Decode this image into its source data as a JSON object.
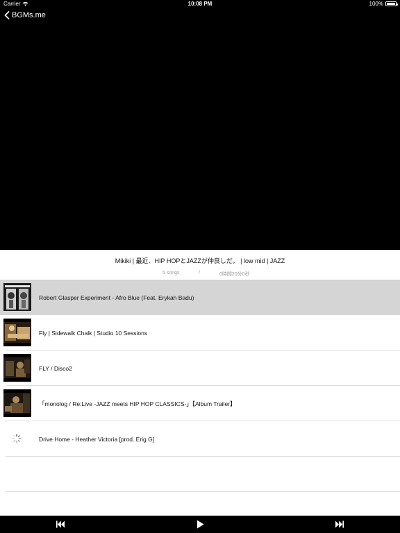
{
  "status_bar": {
    "carrier": "Carrier",
    "time": "10:08 PM",
    "battery": "100%"
  },
  "nav": {
    "back_label": "BGMs.me"
  },
  "playlist": {
    "title": "Mikiki | 最近、HIP HOPとJAZZが仲良しだ。 | low mid | JAZZ",
    "song_count": "5 songs",
    "separator": "/",
    "duration": "0時間20分0秒"
  },
  "songs": [
    {
      "title": "Robert Glasper Experiment - Afro Blue (Feat. Erykah Badu)",
      "selected": true
    },
    {
      "title": "Fly | Sidewalk Chalk | Studio 10 Sessions",
      "selected": false
    },
    {
      "title": "FLY / Disco2",
      "selected": false
    },
    {
      "title": "「monolog / Re:Live -JAZZ meets HIP HOP CLASSICS-」【Album Trailer】",
      "selected": false
    },
    {
      "title": "Drive Home - Heather Victoria [prod. Erig G]",
      "selected": false
    }
  ],
  "colors": {
    "selected_row": "#d5d5d5",
    "divider": "#dcdcdc",
    "meta_text": "#9a9a9a"
  },
  "toolbar": {
    "icons": [
      "previous-track-icon",
      "play-icon",
      "next-track-icon"
    ]
  }
}
